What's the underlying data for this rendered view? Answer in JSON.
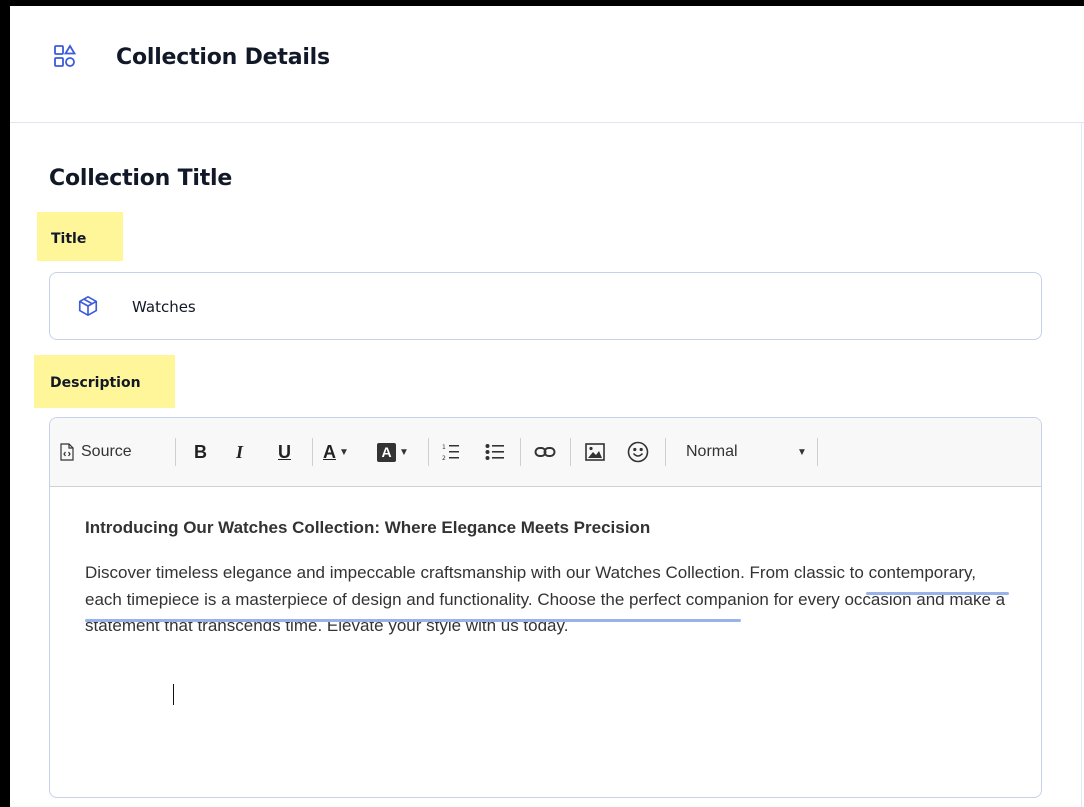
{
  "header": {
    "title": "Collection Details",
    "icon": "category-grid-icon"
  },
  "section": {
    "title": "Collection Title"
  },
  "title_field": {
    "label": "Title",
    "value": "Watches",
    "icon": "cube-icon"
  },
  "description_field": {
    "label": "Description",
    "toolbar": {
      "source_label": "Source",
      "bold_label": "B",
      "italic_label": "I",
      "underline_label": "U",
      "text_color_label": "A",
      "bg_color_label": "A",
      "format_label": "Normal"
    },
    "heading": "Introducing Our Watches Collection: Where Elegance Meets Precision",
    "paragraph": "Discover timeless elegance and impeccable craftsmanship with our Watches Collection. From classic to contemporary, each timepiece is a masterpiece of design and functionality. Choose the perfect companion for every occasion and make a statement that transcends time. Elevate your style with us today."
  },
  "colors": {
    "accent": "#3b5bdb",
    "highlight": "#fff599",
    "spellcheck_underline": "#99b3ea"
  }
}
